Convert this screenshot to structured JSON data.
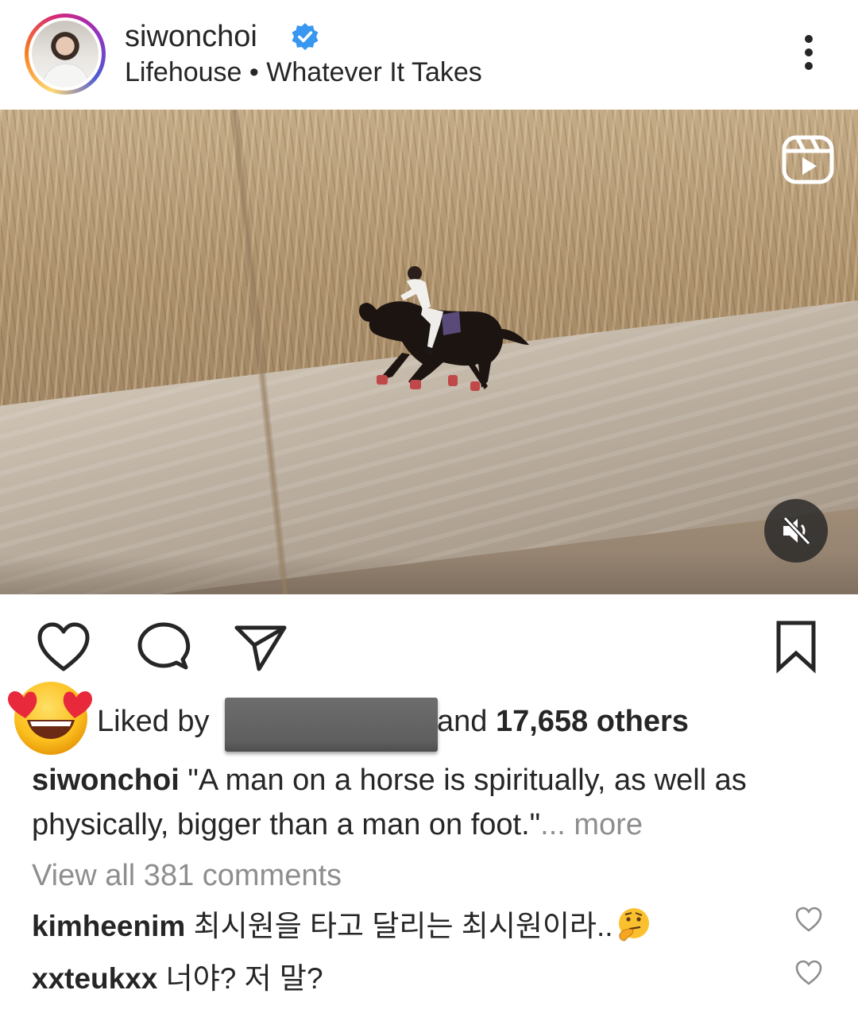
{
  "header": {
    "username": "siwonchoi",
    "audio_artist": "Lifehouse",
    "audio_separator": "•",
    "audio_title": "Whatever It Takes"
  },
  "media": {
    "type": "reel",
    "badge_icon": "reels-icon",
    "sound_state": "muted"
  },
  "actions": {
    "icons": [
      "heart-icon",
      "comment-icon",
      "share-icon",
      "bookmark-icon"
    ]
  },
  "likes": {
    "prefix": "Liked by",
    "connector": "and",
    "count_text": "17,658 others",
    "emoji": "heart-eyes-emoji"
  },
  "caption": {
    "username": "siwonchoi",
    "line1": "\"A man on a horse is spiritually, as well as",
    "line2": "physically, bigger than a man on foot.\"",
    "more": "... more"
  },
  "view_all_comments": "View all 381 comments",
  "comments": [
    {
      "username": "kimheenim",
      "text": "최시원을 타고 달리는 최시원이라..",
      "emoji": "thinking-face-emoji"
    },
    {
      "username": "xxteukxx",
      "text": "너야? 저 말?"
    }
  ],
  "colors": {
    "primary_text": "#262626",
    "secondary_text": "#8e8e8e",
    "verified_blue": "#3897f0"
  }
}
